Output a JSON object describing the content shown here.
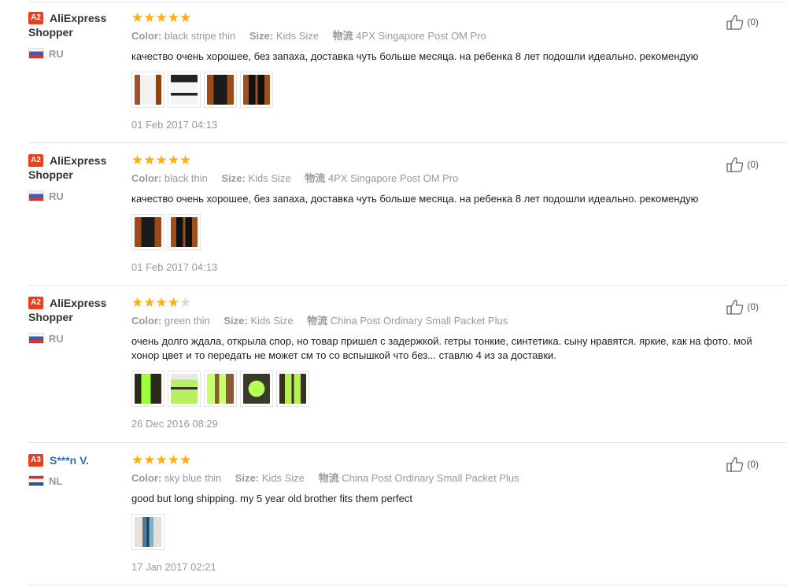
{
  "reviews": [
    {
      "badge": "A2",
      "name_line1": "AliExpress",
      "name_line2": "Shopper",
      "country": "RU",
      "rating": 5,
      "color_label": "Color:",
      "color_value": "black stripe thin",
      "size_label": "Size:",
      "size_value": "Kids Size",
      "ship_label": "物流",
      "ship_value": "4PX Singapore Post OM Pro",
      "text": "качество очень хорошее, без запаха, доставка чуть больше месяца. на ребенка 8 лет подошли идеально. рекомендую",
      "images": [
        "white-sock-photo-1",
        "white-sock-photo-2",
        "black-sock-photo",
        "black-sock-photo-2"
      ],
      "date": "01 Feb 2017 04:13",
      "helpful_count": "(0)"
    },
    {
      "badge": "A2",
      "name_line1": "AliExpress",
      "name_line2": "Shopper",
      "country": "RU",
      "rating": 5,
      "color_label": "Color:",
      "color_value": "black thin",
      "size_label": "Size:",
      "size_value": "Kids Size",
      "ship_label": "物流",
      "ship_value": "4PX Singapore Post OM Pro",
      "text": "качество очень хорошее, без запаха, доставка чуть больше месяца. на ребенка 8 лет подошли идеально. рекомендую",
      "images": [
        "black-sock-photo",
        "black-sock-photo-2"
      ],
      "date": "01 Feb 2017 04:13",
      "helpful_count": "(0)"
    },
    {
      "badge": "A2",
      "name_line1": "AliExpress",
      "name_line2": "Shopper",
      "country": "RU",
      "rating": 4,
      "color_label": "Color:",
      "color_value": "green thin",
      "size_label": "Size:",
      "size_value": "Kids Size",
      "ship_label": "物流",
      "ship_value": "China Post Ordinary Small Packet Plus",
      "text": "очень долго ждала, открыла спор, но товар пришел с задержкой. гетры тонкие, синтетика. сыну нравятся. яркие, как на фото. мой хонор цвет и то передать не может см то со вспышкой что без... ставлю 4 из за доставки.",
      "images": [
        "green-sock-photo-1",
        "green-sock-photo-2",
        "green-sock-photo-3",
        "green-sock-photo-4",
        "green-sock-photo-5"
      ],
      "date": "26 Dec 2016 08:29",
      "helpful_count": "(0)"
    },
    {
      "badge": "A3",
      "name_line1": "S***n V.",
      "name_line2": "",
      "country": "NL",
      "rating": 5,
      "color_label": "Color:",
      "color_value": "sky blue thin",
      "size_label": "Size:",
      "size_value": "Kids Size",
      "ship_label": "物流",
      "ship_value": "China Post Ordinary Small Packet Plus",
      "text": "good but long shipping. my 5 year old brother fits them perfect",
      "images": [
        "blue-sock-photo"
      ],
      "date": "17 Jan 2017 02:21",
      "helpful_count": "(0)"
    }
  ],
  "colors": {
    "star_on": "#ffad0f",
    "star_off": "#d9d9d9",
    "badge": "#e6401f",
    "link": "#2a6ebb"
  }
}
